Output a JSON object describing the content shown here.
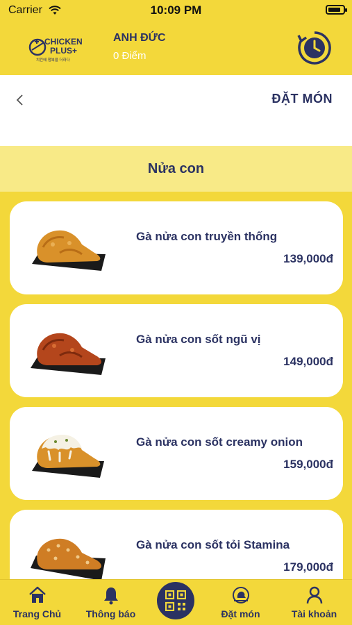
{
  "status": {
    "carrier": "Carrier",
    "time": "10:09 PM",
    "battery_level": 0.85
  },
  "header": {
    "logo_text": "CHICKEN PLUS+",
    "user_name": "ANH ĐỨC",
    "points": "0 Điểm"
  },
  "nav": {
    "title": "ĐẶT MÓN"
  },
  "category": {
    "title": "Nửa con"
  },
  "products": [
    {
      "name": "Gà nửa con truyền thống",
      "price": "139,000đ",
      "sauce": "plain"
    },
    {
      "name": "Gà nửa con sốt ngũ vị",
      "price": "149,000đ",
      "sauce": "spicy"
    },
    {
      "name": "Gà nửa con sốt creamy onion",
      "price": "159,000đ",
      "sauce": "creamy"
    },
    {
      "name": "Gà nửa con sốt tỏi Stamina",
      "price": "179,000đ",
      "sauce": "garlic"
    }
  ],
  "tabbar": {
    "home": "Trang Chủ",
    "notifications": "Thông báo",
    "order": "Đặt món",
    "account": "Tài khoản"
  },
  "colors": {
    "accent": "#f3d83a",
    "navy": "#2b3262",
    "category_bg": "#f8ea87"
  }
}
